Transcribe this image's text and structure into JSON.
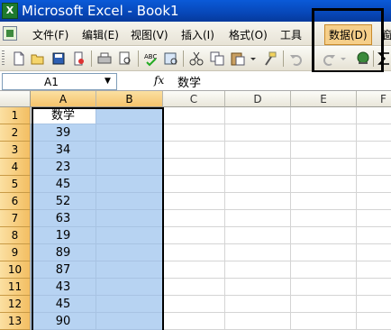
{
  "window": {
    "app_icon_label": "X",
    "title": "Microsoft Excel - Book1"
  },
  "menu": [
    {
      "label": "文件(F)",
      "name": "menu-file"
    },
    {
      "label": "编辑(E)",
      "name": "menu-edit"
    },
    {
      "label": "视图(V)",
      "name": "menu-view"
    },
    {
      "label": "插入(I)",
      "name": "menu-insert"
    },
    {
      "label": "格式(O)",
      "name": "menu-format"
    },
    {
      "label": "工具",
      "name": "menu-tools"
    },
    {
      "label": "数据(D)",
      "name": "menu-data"
    },
    {
      "label": "窗",
      "name": "menu-window"
    }
  ],
  "toolbar": {
    "icons": [
      "new-icon",
      "open-icon",
      "save-icon",
      "permission-icon",
      "print-icon",
      "print-preview-icon",
      "spelling-icon",
      "research-icon",
      "cut-icon",
      "copy-icon",
      "paste-icon",
      "format-painter-icon",
      "undo-icon",
      "redo-icon",
      "hyperlink-icon",
      "autosum-icon"
    ]
  },
  "formula_bar": {
    "name_box": "A1",
    "fx_label": "fx",
    "value": "数学"
  },
  "sheet": {
    "columns": [
      "A",
      "B",
      "C",
      "D",
      "E",
      "F"
    ],
    "rows": [
      {
        "num": "1",
        "a": "数学"
      },
      {
        "num": "2",
        "a": "39"
      },
      {
        "num": "3",
        "a": "34"
      },
      {
        "num": "4",
        "a": "23"
      },
      {
        "num": "5",
        "a": "45"
      },
      {
        "num": "6",
        "a": "52"
      },
      {
        "num": "7",
        "a": "63"
      },
      {
        "num": "8",
        "a": "19"
      },
      {
        "num": "9",
        "a": "89"
      },
      {
        "num": "10",
        "a": "87"
      },
      {
        "num": "11",
        "a": "43"
      },
      {
        "num": "12",
        "a": "45"
      },
      {
        "num": "13",
        "a": "90"
      }
    ]
  }
}
